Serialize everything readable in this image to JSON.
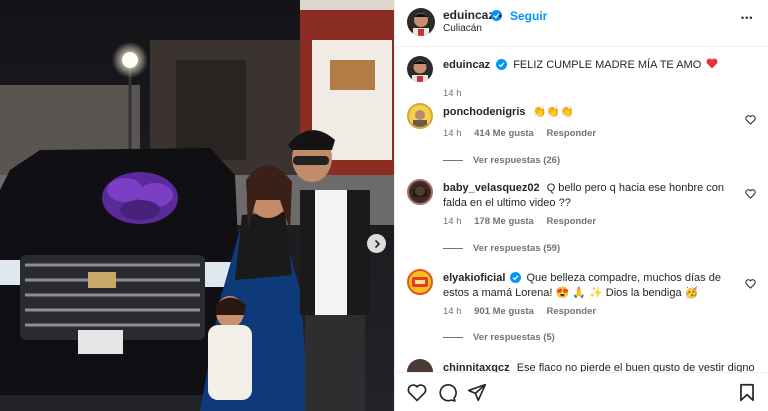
{
  "post": {
    "author": "eduincaz",
    "follow_label": "Seguir",
    "separator": "•",
    "location": "Culiacán",
    "more_label": "•••",
    "caption": "FELIZ CUMPLE MADRE MÍA TE AMO",
    "caption_time": "14 h"
  },
  "comments": [
    {
      "user": "ponchodenigris",
      "text": "👏👏👏",
      "time": "14 h",
      "likes": "414 Me gusta",
      "reply_label": "Responder",
      "replies": "Ver respuestas (26)"
    },
    {
      "user": "baby_velasquez02",
      "text": "Q bello pero q hacia ese honbre con falda en el ultimo video ??",
      "time": "14 h",
      "likes": "178 Me gusta",
      "reply_label": "Responder",
      "replies": "Ver respuestas (59)"
    },
    {
      "user": "elyakioficial",
      "text": "Que belleza compadre, muchos días de estos a mamá Lorena! 😍 🙏 ✨ Dios la bendiga 🥳",
      "time": "14 h",
      "likes": "901 Me gusta",
      "reply_label": "Responder",
      "replies": "Ver respuestas (5)"
    },
    {
      "user": "chinnitaxgcz",
      "text": "Ese flaco no pierde el buen gusto de vestir digno"
    }
  ],
  "colors": {
    "accent": "#0095f6",
    "heart_red": "#ed4956",
    "text": "#262626",
    "muted": "#737373"
  },
  "icons": [
    "verified-icon",
    "more-icon",
    "like-heart-icon",
    "comment-icon",
    "share-icon",
    "bookmark-icon",
    "next-arrow-icon"
  ]
}
